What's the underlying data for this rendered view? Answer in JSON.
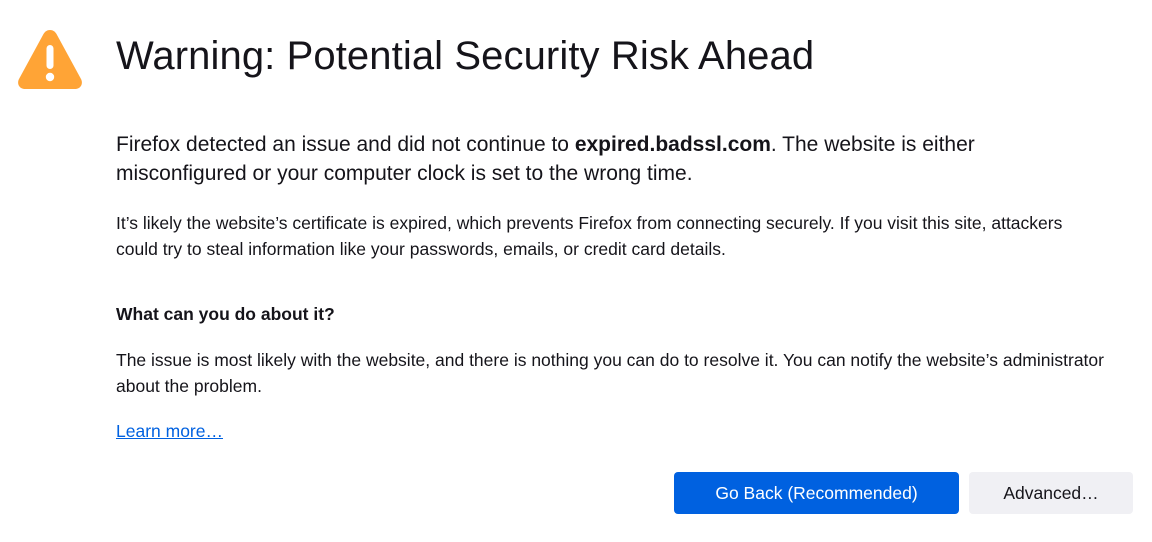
{
  "header": {
    "title": "Warning: Potential Security Risk Ahead"
  },
  "intro": {
    "before": "Firefox detected an issue and did not continue to ",
    "host": "expired.badssl.com",
    "after": ". The website is either misconfigured or your computer clock is set to the wrong time."
  },
  "description": "It’s likely the website’s certificate is expired, which prevents Firefox from connecting securely. If you visit this site, attackers could try to steal information like your passwords, emails, or credit card details.",
  "what_to_do": {
    "heading": "What can you do about it?",
    "body": "The issue is most likely with the website, and there is nothing you can do to resolve it. You can notify the website’s administrator about the problem."
  },
  "learn_more": "Learn more…",
  "buttons": {
    "go_back": "Go Back (Recommended)",
    "advanced": "Advanced…"
  },
  "colors": {
    "warning_icon": "#ffa436",
    "primary_button": "#0061e0",
    "secondary_button": "#f0f0f4",
    "link": "#0061e0",
    "text": "#15141a"
  },
  "icons": {
    "warning": "warning-triangle-icon"
  }
}
